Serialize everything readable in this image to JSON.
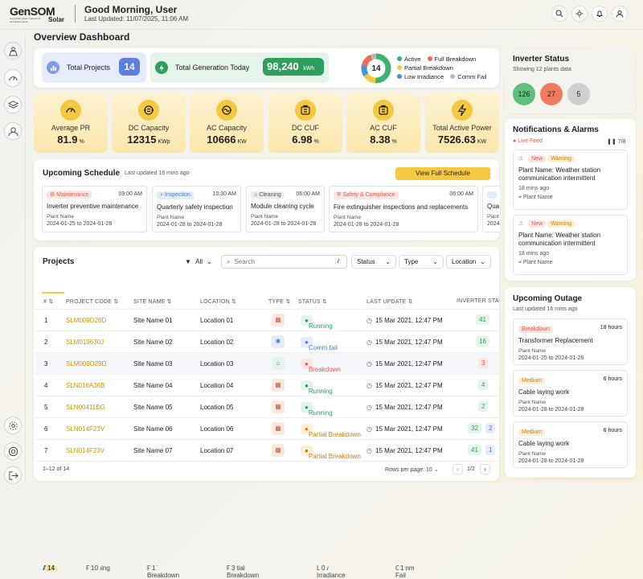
{
  "header": {
    "logo_main": "GenSOM",
    "logo_sub": "Solar",
    "logo_tag": "Generating Solar Operations and Maintenance",
    "greeting": "Good Morning, User",
    "last_updated": "Last Updated: 11/07/2025, 11:06 AM"
  },
  "page_title": "Overview Dashboard",
  "summary": {
    "total_projects_label": "Total Projects",
    "total_projects": "14",
    "total_generation_label": "Total Generation Today",
    "total_generation": "98,240",
    "total_generation_unit": "kWh",
    "donut_center": "14",
    "legend": [
      {
        "label": "Active",
        "color": "#3cb371"
      },
      {
        "label": "Full Breakdown",
        "color": "#ef6c4f"
      },
      {
        "label": "Partial Breakdown",
        "color": "#f5c842"
      },
      {
        "label": "Low Irradiance",
        "color": "#4a90d9"
      },
      {
        "label": "Comm Fail",
        "color": "#bbbbbb"
      }
    ]
  },
  "kpis": [
    {
      "label": "Average PR",
      "value": "81.9",
      "unit": "%"
    },
    {
      "label": "DC Capacity",
      "value": "12315",
      "unit": "KWp"
    },
    {
      "label": "AC Capacity",
      "value": "10666",
      "unit": "KW"
    },
    {
      "label": "DC CUF",
      "value": "6.98",
      "unit": "%"
    },
    {
      "label": "AC CUF",
      "value": "8.38",
      "unit": "%"
    },
    {
      "label": "Total Active Power",
      "value": "7526.63",
      "unit": "KW"
    }
  ],
  "schedule": {
    "title": "Upcoming Schedule",
    "updated": "Last updated 16 mins ago",
    "button": "View Full Schedule",
    "plant_label": "Plant Name",
    "items": [
      {
        "tag": "Maintenance",
        "tag_color": "#e05a4f",
        "tag_bg": "#fde5e2",
        "time": "09:00 AM",
        "title": "Inverter preventive maintenance",
        "dates": "2024-01-25 to 2024-01-28"
      },
      {
        "tag": "Inspection",
        "tag_color": "#4a78c9",
        "tag_bg": "#e3ecfb",
        "time": "10:30 AM",
        "title": "Quarterly safety inspection",
        "dates": "2024-01-28 to 2024-01-28"
      },
      {
        "tag": "Cleaning",
        "tag_color": "#555555",
        "tag_bg": "#ececec",
        "time": "06:00 AM",
        "title": "Module cleaning cycle",
        "dates": "2024-01-28 to 2024-01-28"
      },
      {
        "tag": "Safety & Compliance",
        "tag_color": "#e05a4f",
        "tag_bg": "#fde5e2",
        "time": "06:00 AM",
        "title": "Fire extinguisher inspections and replacements",
        "dates": "2024-01-28 to 2024-01-28"
      },
      {
        "tag": "",
        "tag_color": "#4a78c9",
        "tag_bg": "#e3ecfb",
        "time": "",
        "title": "Qua",
        "dates": "2024"
      }
    ]
  },
  "projects": {
    "title": "Projects",
    "filter_all": "All",
    "search_placeholder": "Search",
    "shortcut": "/",
    "status_label": "Status",
    "type_label": "Type",
    "location_label": "Location",
    "tabs": [
      {
        "label": "All",
        "count": "14"
      },
      {
        "label": "Running",
        "count": "10"
      },
      {
        "label": "Full Breakdown",
        "count": "1"
      },
      {
        "label": "Partial Breakdown",
        "count": "3"
      },
      {
        "label": "Low Irradiance",
        "count": "0"
      },
      {
        "label": "Comm Fail",
        "count": "1"
      }
    ],
    "columns": [
      "#",
      "PROJECT CODE",
      "SITE NAME",
      "LOCATION",
      "TYPE",
      "STATUS",
      "LAST UPDATE",
      "INVERTER STAT"
    ],
    "rows": [
      {
        "n": "1",
        "code": "SLM009D26D",
        "site": "Site Name 01",
        "loc": "Location 01",
        "status": "Running",
        "upd": "15 Mar 2021, 12:47 PM",
        "inv1": "41",
        "inv2": ""
      },
      {
        "n": "2",
        "code": "SLM019630J",
        "site": "Site Name 02",
        "loc": "Location 02",
        "status": "Comm fail",
        "upd": "15 Mar 2021, 12:47 PM",
        "inv1": "16",
        "inv2": ""
      },
      {
        "n": "3",
        "code": "SLM009D29D",
        "site": "Site Name 03",
        "loc": "Location 03",
        "status": "Breakdown",
        "upd": "15 Mar 2021, 12:47 PM",
        "inv1": "3",
        "inv2": ""
      },
      {
        "n": "4",
        "code": "SLN016A36B",
        "site": "Site Name 04",
        "loc": "Location 04",
        "status": "Running",
        "upd": "15 Mar 2021, 12:47 PM",
        "inv1": "4",
        "inv2": ""
      },
      {
        "n": "5",
        "code": "SLN00411BG",
        "site": "Site Name 05",
        "loc": "Location 05",
        "status": "Running",
        "upd": "15 Mar 2021, 12:47 PM",
        "inv1": "2",
        "inv2": ""
      },
      {
        "n": "6",
        "code": "SLN014F23V",
        "site": "Site Name 06",
        "loc": "Location 06",
        "status": "Partial Breakdown",
        "upd": "15 Mar 2021, 12:47 PM",
        "inv1": "32",
        "inv2": "2"
      },
      {
        "n": "7",
        "code": "SLN014F23V",
        "site": "Site Name 07",
        "loc": "Location 07",
        "status": "Partial Breakdown",
        "upd": "15 Mar 2021, 12:47 PM",
        "inv1": "41",
        "inv2": "1"
      }
    ],
    "footer": "1–12 of 14",
    "rows_per_page": "Rows per page: 10",
    "page": "1/2"
  },
  "inverter": {
    "title": "Inverter Status",
    "subtitle": "Showing 12 plants data",
    "green": "126",
    "red": "27",
    "grey": "5"
  },
  "notifications": {
    "title": "Notifications & Alarms",
    "live": "Live Feed",
    "pager": "7/8",
    "items": [
      {
        "new": "New",
        "level": "Warning",
        "plant": "Plant Name: Weather station communication intermittent",
        "ago": "18 mins ago",
        "loc": "Plant Name"
      },
      {
        "new": "New",
        "level": "Warning",
        "plant": "Plant Name: Weather station communication intermittent",
        "ago": "18 mins ago",
        "loc": "Plant Name"
      }
    ]
  },
  "outage": {
    "title": "Upcoming Outage",
    "updated": "Last updated 16 mins ago",
    "plant_label": "Plant Name",
    "items": [
      {
        "tag": "Breakdown",
        "tag_color": "#e05a4f",
        "tag_bg": "#fde5e2",
        "hours": "18 hours",
        "title": "Transformer Replacement",
        "dates": "2024-01-25 to 2024-01-26"
      },
      {
        "tag": "Medium",
        "tag_color": "#c87d12",
        "tag_bg": "#fdefd7",
        "hours": "6 hours",
        "title": "Cable laying work",
        "dates": "2024-01-28 to 2024-01-28"
      },
      {
        "tag": "Medium",
        "tag_color": "#c87d12",
        "tag_bg": "#fdefd7",
        "hours": "6 hours",
        "title": "Cable laying work",
        "dates": "2024-01-28 to 2024-01-28"
      }
    ]
  }
}
